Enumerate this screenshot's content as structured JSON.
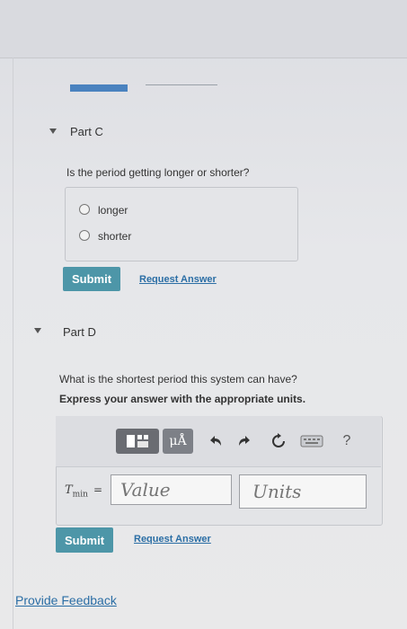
{
  "partC": {
    "title": "Part C",
    "question": "Is the period getting longer or shorter?",
    "options": [
      "longer",
      "shorter"
    ],
    "submit": "Submit",
    "request": "Request Answer"
  },
  "partD": {
    "title": "Part D",
    "question": "What is the shortest period this system can have?",
    "instruction": "Express your answer with the appropriate units.",
    "toolbar": {
      "units_symbol": "μÅ",
      "help": "?"
    },
    "variable": "T",
    "variable_sub": "min",
    "equals": "=",
    "value_placeholder": "Value",
    "units_placeholder": "Units",
    "submit": "Submit",
    "request": "Request Answer"
  },
  "feedback": "Provide Feedback",
  "colors": {
    "accent": "#4d96a8",
    "link": "#2b6ea5",
    "tab_active": "#4a82bf"
  }
}
